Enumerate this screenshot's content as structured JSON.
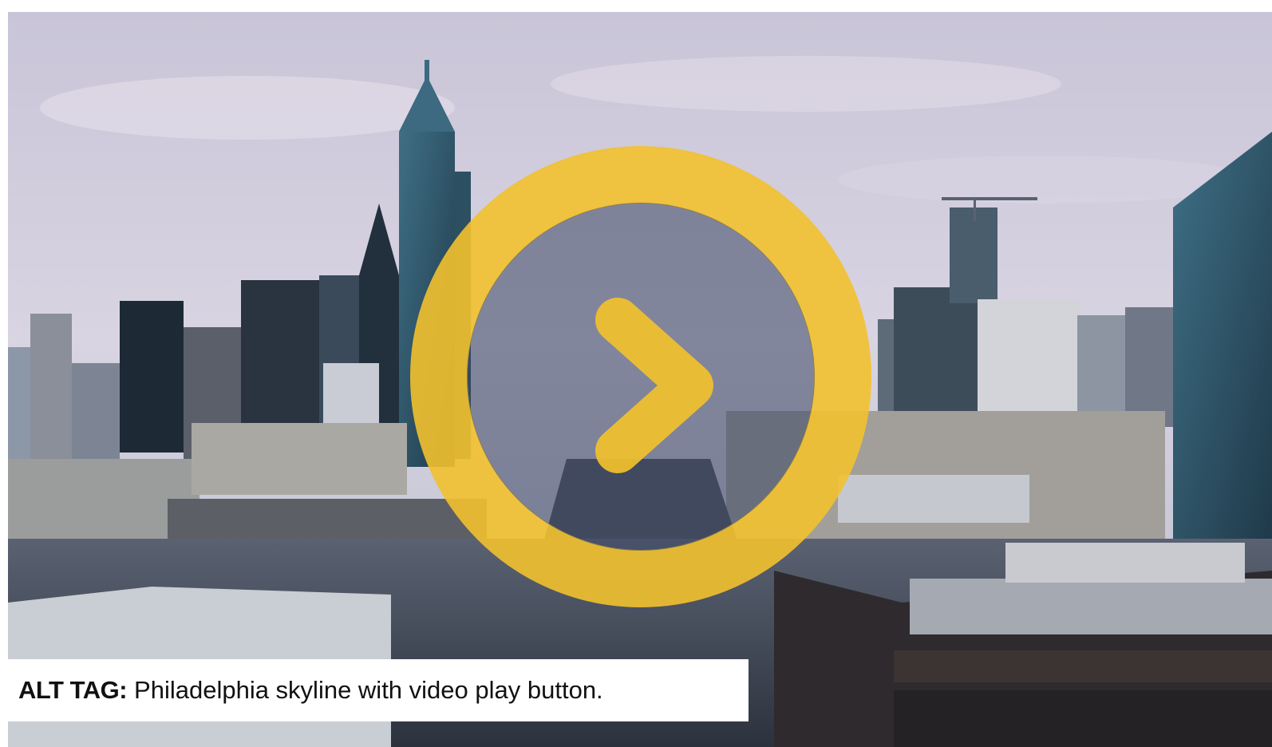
{
  "caption": {
    "label": "ALT TAG:",
    "text": "Philadelphia skyline with video play button."
  },
  "media": {
    "play_icon": "play-icon",
    "accent_color": "#F2C12E",
    "overlay_color": "#3A4562"
  }
}
